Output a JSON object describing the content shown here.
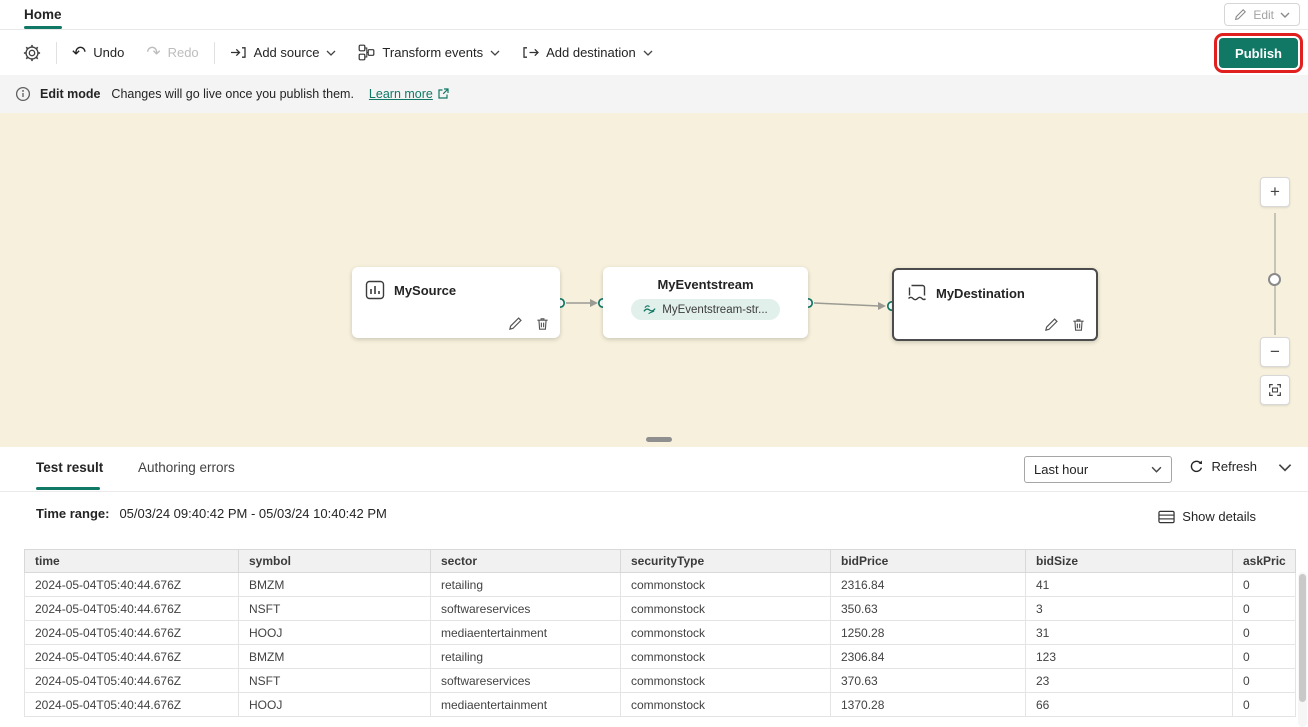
{
  "colors": {
    "accent": "#117865",
    "canvas_background": "#f6f0dc",
    "publish_background": "#117865",
    "highlight_red": "#e01f1f",
    "link": "#117865"
  },
  "topbar": {
    "home_tab": "Home",
    "edit_button": "Edit"
  },
  "toolbar": {
    "undo": "Undo",
    "redo": "Redo",
    "add_source": "Add source",
    "transform_events": "Transform events",
    "add_destination": "Add destination",
    "publish": "Publish"
  },
  "banner": {
    "title": "Edit mode",
    "message": "Changes will go live once you publish them.",
    "learn_more": "Learn more"
  },
  "canvas": {
    "source_node": {
      "title": "MySource"
    },
    "eventstream_node": {
      "title": "MyEventstream",
      "badge": "MyEventstream-str..."
    },
    "destination_node": {
      "title": "MyDestination"
    },
    "zoom": {
      "zoom_in": "+",
      "zoom_out": "−"
    }
  },
  "bottom_panel": {
    "tabs": {
      "test_result": "Test result",
      "authoring_errors": "Authoring errors"
    },
    "time_filter_selected": "Last hour",
    "refresh": "Refresh",
    "time_range": {
      "label": "Time range:",
      "value": "05/03/24 09:40:42 PM  -  05/03/24 10:40:42 PM"
    },
    "show_details": "Show details",
    "table": {
      "columns": [
        "time",
        "symbol",
        "sector",
        "securityType",
        "bidPrice",
        "bidSize",
        "askPric"
      ],
      "rows": [
        [
          "2024-05-04T05:40:44.676Z",
          "BMZM",
          "retailing",
          "commonstock",
          "2316.84",
          "41",
          "0"
        ],
        [
          "2024-05-04T05:40:44.676Z",
          "NSFT",
          "softwareservices",
          "commonstock",
          "350.63",
          "3",
          "0"
        ],
        [
          "2024-05-04T05:40:44.676Z",
          "HOOJ",
          "mediaentertainment",
          "commonstock",
          "1250.28",
          "31",
          "0"
        ],
        [
          "2024-05-04T05:40:44.676Z",
          "BMZM",
          "retailing",
          "commonstock",
          "2306.84",
          "123",
          "0"
        ],
        [
          "2024-05-04T05:40:44.676Z",
          "NSFT",
          "softwareservices",
          "commonstock",
          "370.63",
          "23",
          "0"
        ],
        [
          "2024-05-04T05:40:44.676Z",
          "HOOJ",
          "mediaentertainment",
          "commonstock",
          "1370.28",
          "66",
          "0"
        ]
      ]
    }
  }
}
